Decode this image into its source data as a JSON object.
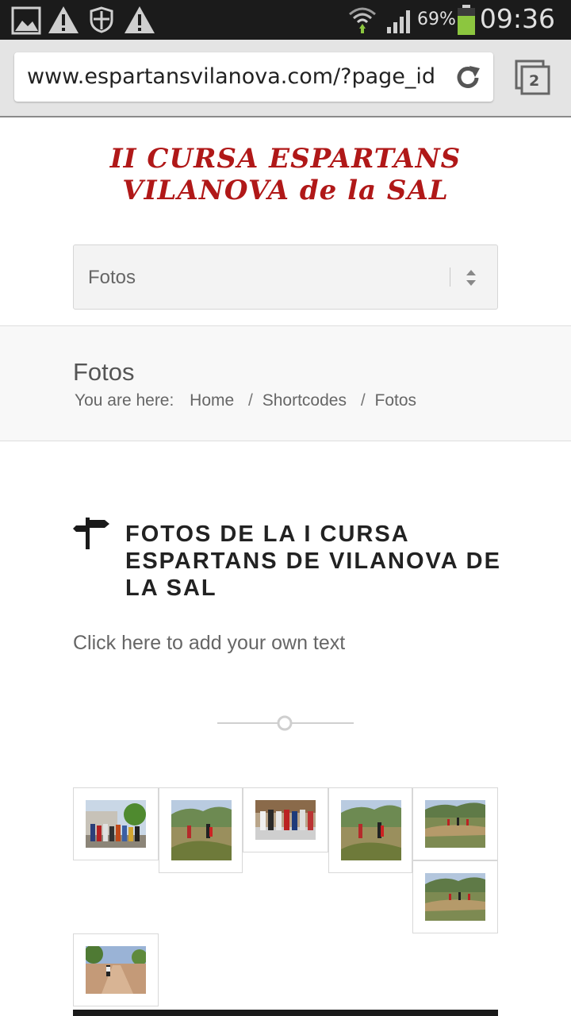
{
  "status_bar": {
    "battery_percent": "69%",
    "time": "09:36",
    "icons": [
      "gallery-icon",
      "warning-icon",
      "shield-icon",
      "warning-icon",
      "wifi-icon",
      "signal-icon",
      "battery-icon"
    ]
  },
  "browser": {
    "url": "www.espartansvilanova.com/?page_id",
    "tab_count": "2"
  },
  "header": {
    "logo_line1": "II CURSA ESPARTANS",
    "logo_line2": "VILANOVA de la SAL",
    "menu_selected": "Fotos"
  },
  "title_bar": {
    "title": "Fotos",
    "breadcrumb_prefix": "You are here:",
    "breadcrumb": [
      "Home",
      "Shortcodes",
      "Fotos"
    ],
    "breadcrumb_separator": "/"
  },
  "content": {
    "heading": "FOTOS DE LA I CURSA ESPARTANS DE VILANOVA DE LA SAL",
    "subtext": "Click here to add your own text"
  },
  "gallery": {
    "photos": [
      {
        "name": "photo-runners-start"
      },
      {
        "name": "photo-runners-trail-1"
      },
      {
        "name": "photo-runners-group"
      },
      {
        "name": "photo-runners-trail-2"
      },
      {
        "name": "photo-trail-landscape-1"
      },
      {
        "name": "photo-trail-landscape-2"
      },
      {
        "name": "photo-runner-dirt-road"
      }
    ]
  },
  "colors": {
    "logo_red": "#b01818",
    "status_bar_bg": "#1b1b1b",
    "battery_green": "#8cc63f"
  }
}
